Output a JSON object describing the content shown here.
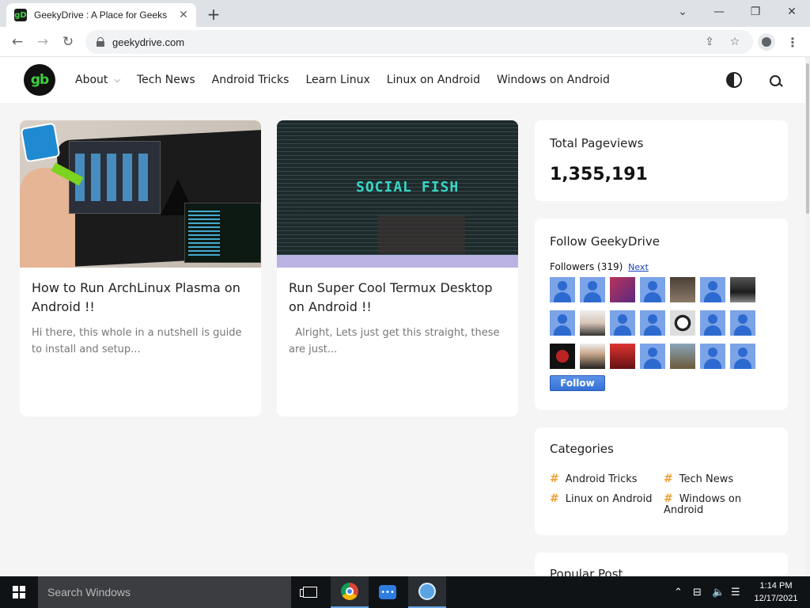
{
  "browser": {
    "tab_title": "GeekyDrive : A Place for Geeks",
    "tab_favicon_text": "gD",
    "tab_close_icon": "close-icon",
    "new_tab_icon": "plus-icon",
    "url": "geekydrive.com",
    "window_controls": [
      "minimize",
      "maximize",
      "close"
    ]
  },
  "site": {
    "logo_text": "gb",
    "nav": [
      {
        "label": "About",
        "has_dropdown": true
      },
      {
        "label": "Tech News"
      },
      {
        "label": "Android Tricks"
      },
      {
        "label": "Learn Linux"
      },
      {
        "label": "Linux on Android"
      },
      {
        "label": "Windows on Android"
      }
    ]
  },
  "posts": [
    {
      "title": "How to Run ArchLinux Plasma on Android !!",
      "excerpt": "Hi there, this whole in a nutshell is guide to install and setup..."
    },
    {
      "title": "Run Super Cool Termux Desktop on Android !!",
      "excerpt": "  Alright, Lets just get this straight, these are just...",
      "thumb_text": "SOCIAL FISH"
    }
  ],
  "sidebar": {
    "pageviews": {
      "title": "Total Pageviews",
      "value": "1,355,191"
    },
    "follow": {
      "title": "Follow GeekyDrive",
      "followers_label": "Followers (319)",
      "next_link": "Next",
      "follow_button": "Follow"
    },
    "categories": {
      "title": "Categories",
      "items": [
        "Android Tricks",
        "Tech News",
        "Linux on Android",
        "Windows on Android"
      ]
    },
    "popular": {
      "title": "Popular Post"
    }
  },
  "taskbar": {
    "search_placeholder": "Search Windows",
    "time": "1:14 PM",
    "date": "12/17/2021"
  },
  "colors": {
    "accent_hash": "#f0a030",
    "follow_button": "#3470d6",
    "page_bg": "#f5f5f5"
  }
}
